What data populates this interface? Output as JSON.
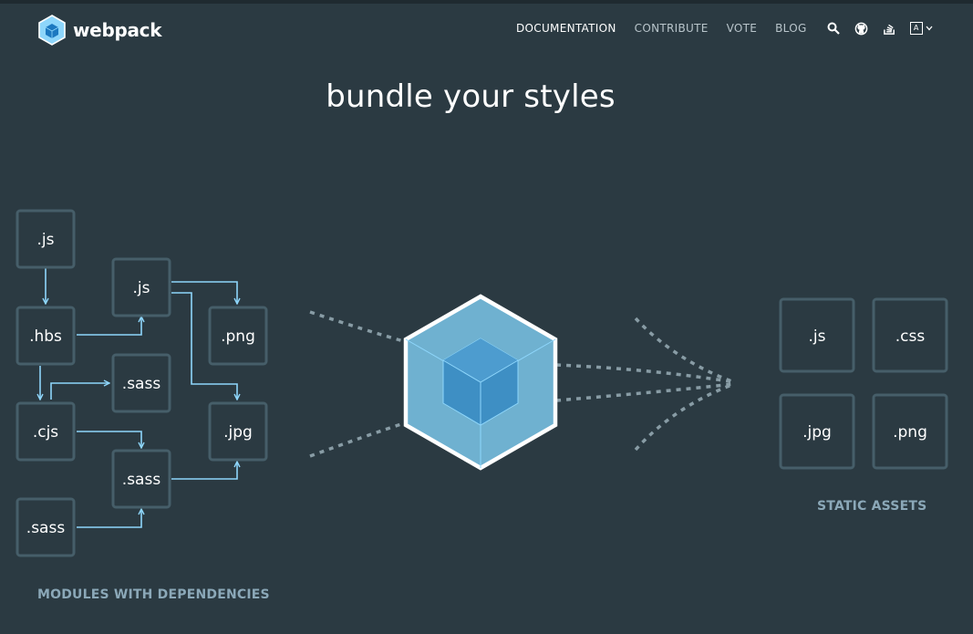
{
  "header": {
    "brand": "webpack",
    "nav": [
      {
        "label": "DOCUMENTATION"
      },
      {
        "label": "CONTRIBUTE"
      },
      {
        "label": "VOTE"
      },
      {
        "label": "BLOG"
      }
    ],
    "icons": [
      "search-icon",
      "github-icon",
      "stackoverflow-icon"
    ],
    "language": {
      "code": "A",
      "icon": "language-icon",
      "chevron": "chevron-down-icon"
    }
  },
  "headline": "bundle your styles",
  "modules": {
    "caption": "MODULES WITH DEPENDENCIES",
    "files": [
      ".js",
      ".js",
      ".hbs",
      ".png",
      ".sass",
      ".cjs",
      ".jpg",
      ".sass",
      ".sass"
    ]
  },
  "assets": {
    "caption": "STATIC ASSETS",
    "files": [
      ".js",
      ".css",
      ".jpg",
      ".png"
    ]
  },
  "colors": {
    "background": "#2b3a42",
    "box_border": "#465e69",
    "connector": "#8ed6fb",
    "cube_outer": "#8ed6fb",
    "cube_inner": "#1c78c0",
    "caption": "#8ba8b8"
  }
}
